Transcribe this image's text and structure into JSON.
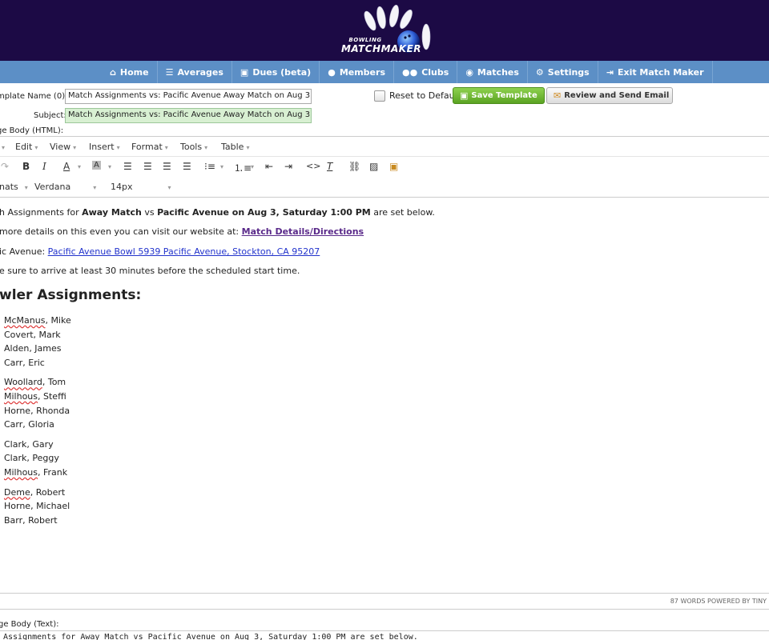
{
  "brand": {
    "logo_small": "BOWLING",
    "logo_main": "MATCHMAKER"
  },
  "nav": [
    {
      "label": "Home",
      "icon": "home-icon",
      "glyph": "⌂"
    },
    {
      "label": "Averages",
      "icon": "list-icon",
      "glyph": "☰"
    },
    {
      "label": "Dues (beta)",
      "icon": "money-icon",
      "glyph": "▣"
    },
    {
      "label": "Members",
      "icon": "user-icon",
      "glyph": "●"
    },
    {
      "label": "Clubs",
      "icon": "group-icon",
      "glyph": "●●"
    },
    {
      "label": "Matches",
      "icon": "bowling-ball-icon",
      "glyph": "◉"
    },
    {
      "label": "Settings",
      "icon": "gear-icon",
      "glyph": "⚙"
    },
    {
      "label": "Exit Match Maker",
      "icon": "exit-icon",
      "glyph": "⇥"
    }
  ],
  "form": {
    "template_name_label": "mplate Name (0):",
    "template_name_value": "Match Assignments vs: Pacific Avenue Away Match on Aug 3, Sa",
    "subject_label": "Subject:",
    "subject_value": "Match Assignments vs: Pacific Avenue Away Match on Aug 3, Sa",
    "body_html_label": "ge Body (HTML):",
    "reset_label": "Reset to Default",
    "save_label": "Save Template",
    "review_label": "Review and Send Email"
  },
  "editor": {
    "menu": [
      "Edit",
      "View",
      "Insert",
      "Format",
      "Tools",
      "Table"
    ],
    "font_format": "nats",
    "font_family": "Verdana",
    "font_size": "14px",
    "status": "87 WORDS POWERED BY TINY"
  },
  "content": {
    "line1_a": "h Assignments for ",
    "line1_b": "Away Match",
    "line1_c": " vs ",
    "line1_d": "Pacific Avenue on Aug 3, Saturday 1:00 PM",
    "line1_e": " are set below.",
    "line2_a": "more details on this even you can visit our website at: ",
    "line2_link": "Match Details/Directions",
    "line3_a": "ic Avenue: ",
    "line3_link": "Pacific Avenue Bowl 5939 Pacific Avenue, Stockton, CA 95207",
    "line4": "e sure to arrive at least 30 minutes before the scheduled start time.",
    "heading": "wler Assignments:",
    "groups": [
      [
        "McManus, Mike",
        "Covert, Mark",
        "Alden, James",
        "Carr, Eric"
      ],
      [
        "Woollard, Tom",
        "Milhous, Steffi",
        "Horne, Rhonda",
        "Carr, Gloria"
      ],
      [
        "Clark, Gary",
        "Clark, Peggy",
        "Milhous, Frank"
      ],
      [
        "Deme, Robert",
        "Horne, Michael",
        "Barr, Robert"
      ]
    ]
  },
  "bottom": {
    "label": "ge Body (Text):",
    "text": " Assignments for Away Match vs Pacific Avenue on Aug 3, Saturday 1:00 PM   are set below."
  }
}
